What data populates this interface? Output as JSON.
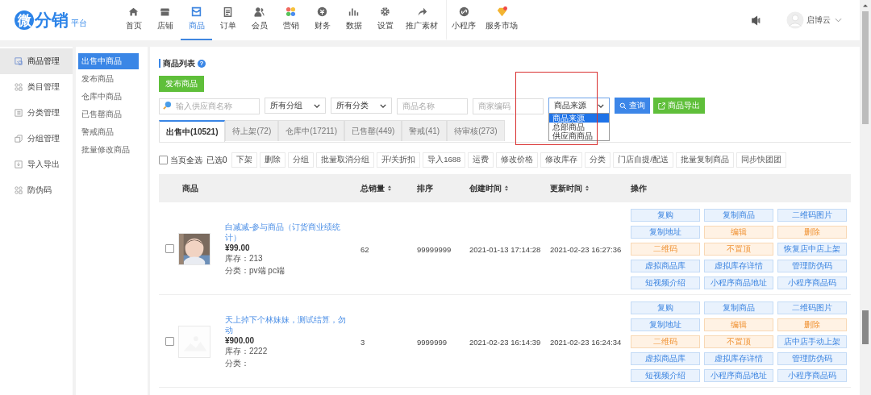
{
  "app": {
    "logo_mark": "微",
    "logo_text": "分销",
    "logo_sub": "平台"
  },
  "nav": [
    {
      "label": "首页",
      "selected": false
    },
    {
      "label": "店铺",
      "selected": false
    },
    {
      "label": "商品",
      "selected": true
    },
    {
      "label": "订单",
      "selected": false
    },
    {
      "label": "会员",
      "selected": false
    },
    {
      "label": "营销",
      "selected": false
    },
    {
      "label": "财务",
      "selected": false
    },
    {
      "label": "数据",
      "selected": false
    },
    {
      "label": "设置",
      "selected": false
    },
    {
      "label": "推广素材",
      "selected": false
    },
    {
      "label": "小程序",
      "selected": false
    },
    {
      "label": "服务市场",
      "selected": false
    }
  ],
  "user": {
    "name": "启博云"
  },
  "sidebar": [
    {
      "label": "商品管理",
      "selected": true
    },
    {
      "label": "类目管理",
      "selected": false
    },
    {
      "label": "分类管理",
      "selected": false
    },
    {
      "label": "分组管理",
      "selected": false
    },
    {
      "label": "导入导出",
      "selected": false
    },
    {
      "label": "防伪码",
      "selected": false
    }
  ],
  "subnav": [
    {
      "label": "出售中商品",
      "selected": true
    },
    {
      "label": "发布商品",
      "selected": false
    },
    {
      "label": "仓库中商品",
      "selected": false
    },
    {
      "label": "已售罄商品",
      "selected": false
    },
    {
      "label": "警戒商品",
      "selected": false
    },
    {
      "label": "批量修改商品",
      "selected": false
    }
  ],
  "page": {
    "title": "商品列表",
    "help_mark": "?",
    "publish_button": "发布商品"
  },
  "filters": [
    {
      "kind": "search_input",
      "placeholder": "输入供应商名称"
    },
    {
      "kind": "select",
      "value": "所有分组"
    },
    {
      "kind": "select",
      "value": "所有分类"
    },
    {
      "kind": "input",
      "placeholder": "商品名称"
    },
    {
      "kind": "input",
      "placeholder": "商家编码"
    },
    {
      "kind": "select",
      "value": "商品来源",
      "open": true,
      "options": [
        {
          "label": "商品来源",
          "selected": true
        },
        {
          "label": "总部商品",
          "selected": false
        },
        {
          "label": "供应商商品",
          "selected": false
        }
      ]
    }
  ],
  "search_button": "查询",
  "export_button": "商品导出",
  "tabs": [
    {
      "label": "出售中(10521)",
      "selected": true
    },
    {
      "label": "待上架(72)",
      "selected": false
    },
    {
      "label": "仓库中(17211)",
      "selected": false
    },
    {
      "label": "已售罄(449)",
      "selected": false
    },
    {
      "label": "警戒(41)",
      "selected": false
    },
    {
      "label": "待审核(273)",
      "selected": false
    }
  ],
  "bulk": {
    "select_all": "当页全选",
    "checked": false,
    "selected_count": "已选0",
    "actions": [
      "下架",
      "删除",
      "分组",
      "批量取消分组",
      "开/关折扣",
      "导入1688",
      "运费",
      "修改价格",
      "修改库存",
      "分类",
      "门店自提/配送",
      "批量复制商品",
      "同步快团团"
    ]
  },
  "table": {
    "columns": [
      {
        "label": "商品",
        "sortable": false
      },
      {
        "label": "总销量",
        "sortable": true
      },
      {
        "label": "排序",
        "sortable": false
      },
      {
        "label": "创建时间",
        "sortable": true
      },
      {
        "label": "更新时间",
        "sortable": true
      },
      {
        "label": "操作",
        "sortable": false
      }
    ],
    "rows": [
      {
        "checked": false,
        "name": "白减减-参与商品（订货商业绩统计）",
        "price": "¥99.00",
        "stock": "库存：213",
        "category": "分类：pv端 pc端",
        "sales": "62",
        "sort": "99999999",
        "created": "2021-01-13 17:14:28",
        "updated": "2021-02-23 16:27:36",
        "actions": [
          {
            "label": "复购",
            "kind": "primary"
          },
          {
            "label": "复制商品",
            "kind": "primary"
          },
          {
            "label": "二维码图片",
            "kind": "primary"
          },
          {
            "label": "复制地址",
            "kind": "primary"
          },
          {
            "label": "编辑",
            "kind": "warning"
          },
          {
            "label": "删除",
            "kind": "warning"
          },
          {
            "label": "二维码",
            "kind": "warning"
          },
          {
            "label": "不置顶",
            "kind": "warning"
          },
          {
            "label": "恢复店中店上架",
            "kind": "primary"
          },
          {
            "label": "虚拟商品库",
            "kind": "primary"
          },
          {
            "label": "虚拟库存详情",
            "kind": "primary"
          },
          {
            "label": "管理防伪码",
            "kind": "primary"
          },
          {
            "label": "短视频介绍",
            "kind": "primary"
          },
          {
            "label": "小程序商品地址",
            "kind": "primary"
          },
          {
            "label": "小程序商品码",
            "kind": "primary"
          }
        ]
      },
      {
        "checked": false,
        "name": "天上掉下个林妹妹，测试结算，勿动",
        "price": "¥900.00",
        "stock": "库存：2222",
        "category": "分类：",
        "sales": "3",
        "sort": "9999999",
        "created": "2021-02-23 16:14:39",
        "updated": "2021-02-23 16:24:34",
        "actions": [
          {
            "label": "复购",
            "kind": "primary"
          },
          {
            "label": "复制商品",
            "kind": "primary"
          },
          {
            "label": "二维码图片",
            "kind": "primary"
          },
          {
            "label": "复制地址",
            "kind": "primary"
          },
          {
            "label": "编辑",
            "kind": "warning"
          },
          {
            "label": "删除",
            "kind": "warning"
          },
          {
            "label": "二维码",
            "kind": "warning"
          },
          {
            "label": "不置顶",
            "kind": "warning"
          },
          {
            "label": "店中店手动上架",
            "kind": "primary"
          },
          {
            "label": "虚拟商品库",
            "kind": "primary"
          },
          {
            "label": "虚拟库存详情",
            "kind": "primary"
          },
          {
            "label": "管理防伪码",
            "kind": "primary"
          },
          {
            "label": "短视频介绍",
            "kind": "primary"
          },
          {
            "label": "小程序商品地址",
            "kind": "primary"
          },
          {
            "label": "小程序商品码",
            "kind": "primary"
          }
        ]
      }
    ]
  }
}
